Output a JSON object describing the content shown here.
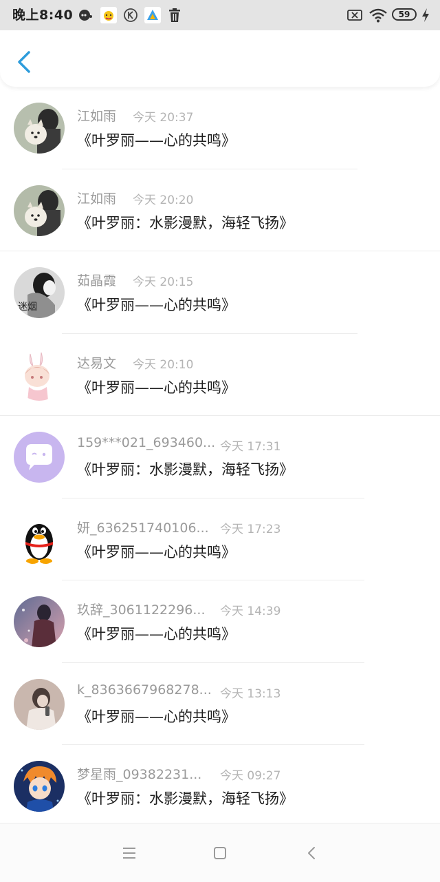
{
  "status_bar": {
    "time": "晚上8:40",
    "battery": "59",
    "icons": [
      "bubble-icon",
      "yellow-app-icon",
      "k-icon",
      "triangle-app-icon",
      "trash-icon",
      "sim-off-icon",
      "wifi-icon",
      "battery-icon",
      "charging-icon"
    ]
  },
  "header": {
    "back_icon": "chevron-left-icon"
  },
  "items": [
    {
      "name": "江如雨",
      "time": "今天 20:37",
      "message": "《叶罗丽——心的共鸣》"
    },
    {
      "name": "江如雨",
      "time": "今天 20:20",
      "message": "《叶罗丽：水影漫默，海轻飞扬》"
    },
    {
      "name": "茹晶霞",
      "time": "今天 20:15",
      "message": "《叶罗丽——心的共鸣》"
    },
    {
      "name": "达易文",
      "time": "今天 20:10",
      "message": "《叶罗丽——心的共鸣》"
    },
    {
      "name": "159***021_693460...",
      "time": "今天 17:31",
      "message": "《叶罗丽：水影漫默，海轻飞扬》"
    },
    {
      "name": "妍_636251740106...",
      "time": "今天 17:23",
      "message": "《叶罗丽——心的共鸣》"
    },
    {
      "name": "玖辞_3061122296...",
      "time": "今天 14:39",
      "message": "《叶罗丽——心的共鸣》"
    },
    {
      "name": "k_8363667968278...",
      "time": "今天 13:13",
      "message": "《叶罗丽——心的共鸣》"
    },
    {
      "name": "梦星雨_09382231...",
      "time": "今天 09:27",
      "message": "《叶罗丽：水影漫默，海轻飞扬》"
    }
  ],
  "avatar_text": "迷烟",
  "nav": {
    "icons": [
      "menu-icon",
      "home-square-icon",
      "back-icon"
    ]
  }
}
